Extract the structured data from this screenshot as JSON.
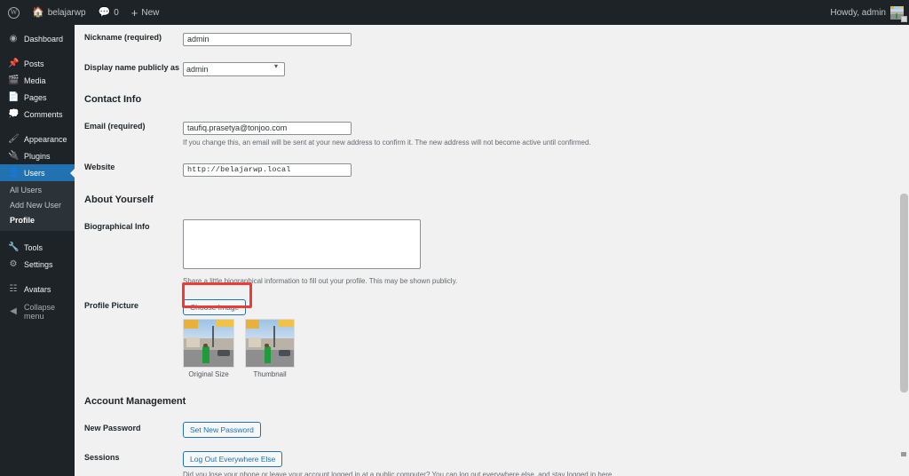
{
  "adminbar": {
    "logo_icon": "wordpress-logo-icon",
    "site_name": "belajarwp",
    "home_icon": "home-icon",
    "comments_icon": "comment-bubble-icon",
    "comments_count": "0",
    "new_icon": "plus-icon",
    "new_label": "New",
    "howdy": "Howdy, admin",
    "avatar_icon": "user-avatar"
  },
  "sidebar": {
    "items": [
      {
        "label": "Dashboard",
        "icon": "dashboard-icon"
      },
      {
        "label": "Posts",
        "icon": "pin-icon"
      },
      {
        "label": "Media",
        "icon": "media-icon"
      },
      {
        "label": "Pages",
        "icon": "page-icon"
      },
      {
        "label": "Comments",
        "icon": "comment-icon"
      },
      {
        "label": "Appearance",
        "icon": "brush-icon"
      },
      {
        "label": "Plugins",
        "icon": "plug-icon"
      },
      {
        "label": "Users",
        "icon": "users-icon"
      },
      {
        "label": "Tools",
        "icon": "tools-icon"
      },
      {
        "label": "Settings",
        "icon": "settings-icon"
      },
      {
        "label": "Avatars",
        "icon": "avatars-icon"
      },
      {
        "label": "Collapse menu",
        "icon": "collapse-icon"
      }
    ],
    "submenu": [
      {
        "label": "All Users"
      },
      {
        "label": "Add New User"
      },
      {
        "label": "Profile"
      }
    ]
  },
  "form": {
    "nickname": {
      "label": "Nickname (required)",
      "value": "admin"
    },
    "display_name": {
      "label": "Display name publicly as",
      "value": "admin",
      "chevron_icon": "chevron-down-icon"
    },
    "contact_heading": "Contact Info",
    "email": {
      "label": "Email (required)",
      "value": "taufiq.prasetya@tonjoo.com",
      "desc": "If you change this, an email will be sent at your new address to confirm it. The new address will not become active until confirmed."
    },
    "website": {
      "label": "Website",
      "value": "http://belajarwp.local"
    },
    "about_heading": "About Yourself",
    "bio": {
      "label": "Biographical Info",
      "value": "",
      "desc": "Share a little biographical information to fill out your profile. This may be shown publicly."
    },
    "profile_picture": {
      "label": "Profile Picture",
      "choose_button": "Choose Image",
      "thumbs": [
        {
          "caption": "Original Size"
        },
        {
          "caption": "Thumbnail"
        }
      ]
    },
    "account_heading": "Account Management",
    "new_password": {
      "label": "New Password",
      "button": "Set New Password"
    },
    "sessions": {
      "label": "Sessions",
      "button": "Log Out Everywhere Else",
      "desc": "Did you lose your phone or leave your account logged in at a public computer? You can log out everywhere else, and stay logged in here."
    }
  },
  "colors": {
    "admin_dark": "#1d2327",
    "accent_blue": "#2271b1",
    "highlight_red": "#ee3b33",
    "page_bg": "#f1f1f1"
  }
}
